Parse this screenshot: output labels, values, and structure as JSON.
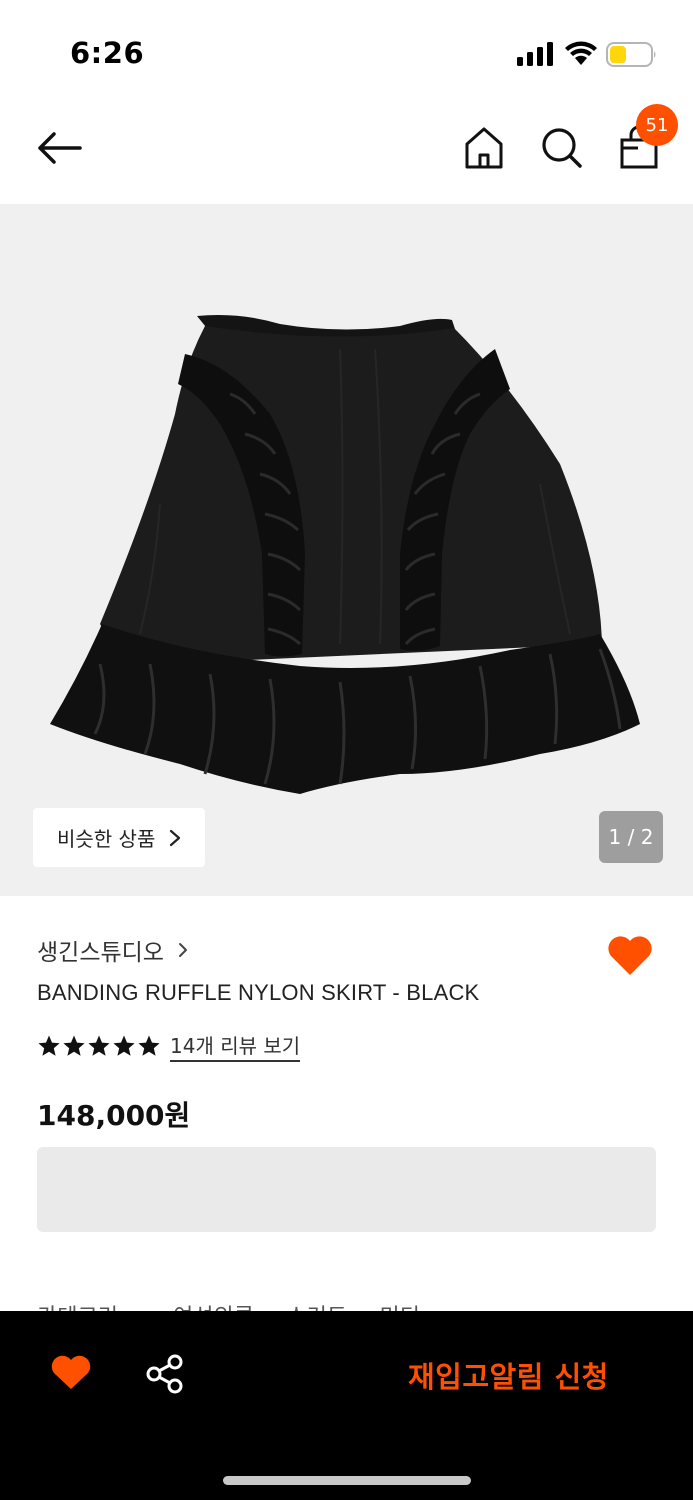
{
  "status_bar": {
    "time": "6:26",
    "signal_icon": "signal-icon",
    "wifi_icon": "wifi-icon",
    "battery_icon": "battery-icon",
    "battery_color": "#ffd60a"
  },
  "nav": {
    "back_icon": "back-arrow-icon",
    "home_icon": "home-icon",
    "search_icon": "search-icon",
    "bag_icon": "shopping-bag-icon",
    "cart_count": "51"
  },
  "hero": {
    "image_icon": "skirt-product-image",
    "similar_label": "비슷한 상품",
    "pager": "1 / 2"
  },
  "product": {
    "brand": "생긴스튜디오",
    "title": "BANDING RUFFLE NYLON SKIRT - BLACK",
    "rating": 5,
    "review_link": "14개 리뷰 보기",
    "price": "148,000원"
  },
  "category": {
    "label": "카테고리",
    "path": "여성의류  >  스커트  >  미디"
  },
  "bottom_bar": {
    "heart_icon": "heart-icon",
    "share_icon": "share-icon",
    "restock_label": "재입고알림 신청"
  },
  "colors": {
    "accent": "#ff5000",
    "background_gray": "#f0f0f0",
    "bottom_bar": "#000000"
  }
}
